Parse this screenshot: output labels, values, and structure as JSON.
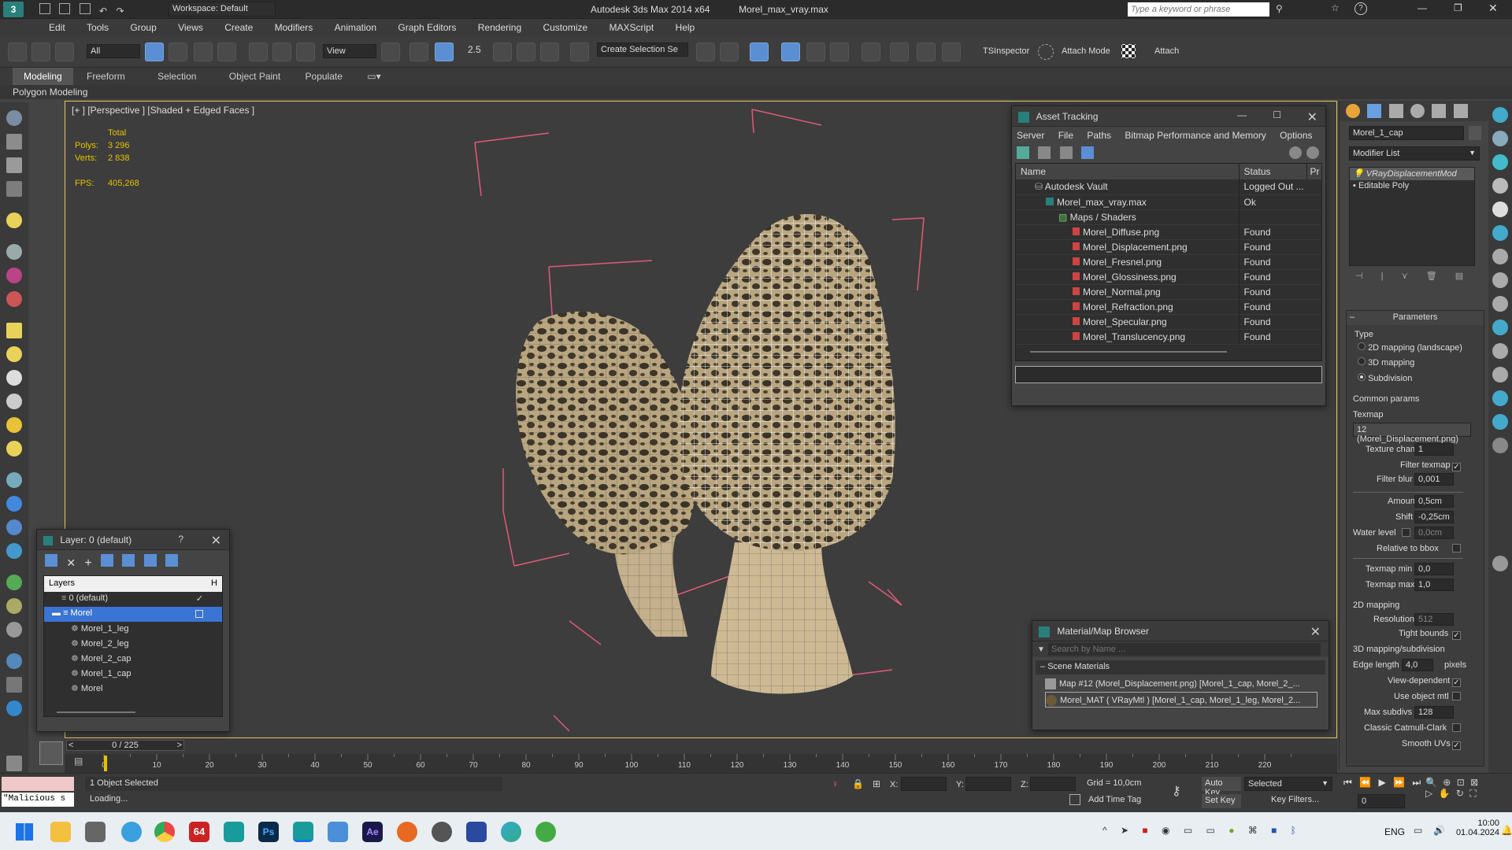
{
  "titlebar": {
    "workspace": "Workspace: Default",
    "app_title": "Autodesk 3ds Max 2014 x64",
    "file_title": "Morel_max_vray.max",
    "search_placeholder": "Type a keyword or phrase"
  },
  "menu": [
    "Edit",
    "Tools",
    "Group",
    "Views",
    "Create",
    "Modifiers",
    "Animation",
    "Graph Editors",
    "Rendering",
    "Customize",
    "MAXScript",
    "Help"
  ],
  "toolbar": {
    "selection_filter": "All",
    "view_dropdown": "View",
    "snap_value": "2.5",
    "create_selection": "Create Selection Se",
    "tsinspector": "TSInspector",
    "attach_mode": "Attach Mode",
    "attach": "Attach"
  },
  "ribbon": {
    "tabs": [
      "Modeling",
      "Freeform",
      "Selection",
      "Object Paint",
      "Populate"
    ],
    "sub_label": "Polygon Modeling"
  },
  "viewport": {
    "label": "[+ ] [Perspective ] [Shaded + Edged Faces ]",
    "stats": {
      "total_label": "Total",
      "polys_label": "Polys:",
      "polys_value": "3 296",
      "verts_label": "Verts:",
      "verts_value": "2 838",
      "fps_label": "FPS:",
      "fps_value": "405,268"
    }
  },
  "asset_tracking": {
    "title": "Asset Tracking",
    "menu": [
      "Server",
      "File",
      "Paths",
      "Bitmap Performance and Memory",
      "Options"
    ],
    "columns": [
      "Name",
      "Status",
      "Pr"
    ],
    "rows": [
      {
        "name": "Autodesk Vault",
        "status": "Logged Out ..."
      },
      {
        "name": "Morel_max_vray.max",
        "status": "Ok"
      },
      {
        "name": "Maps / Shaders",
        "status": ""
      },
      {
        "name": "Morel_Diffuse.png",
        "status": "Found"
      },
      {
        "name": "Morel_Displacement.png",
        "status": "Found"
      },
      {
        "name": "Morel_Fresnel.png",
        "status": "Found"
      },
      {
        "name": "Morel_Glossiness.png",
        "status": "Found"
      },
      {
        "name": "Morel_Normal.png",
        "status": "Found"
      },
      {
        "name": "Morel_Refraction.png",
        "status": "Found"
      },
      {
        "name": "Morel_Specular.png",
        "status": "Found"
      },
      {
        "name": "Morel_Translucency.png",
        "status": "Found"
      }
    ]
  },
  "layer_window": {
    "title": "Layer: 0 (default)",
    "help": "?",
    "header": "Layers",
    "header_h": "H",
    "items": [
      {
        "name": "0 (default)"
      },
      {
        "name": "Morel"
      },
      {
        "name": "Morel_1_leg"
      },
      {
        "name": "Morel_2_leg"
      },
      {
        "name": "Morel_2_cap"
      },
      {
        "name": "Morel_1_cap"
      },
      {
        "name": "Morel"
      }
    ]
  },
  "material_browser": {
    "title": "Material/Map Browser",
    "search_placeholder": "Search by Name ...",
    "section": "Scene Materials",
    "items": [
      "Map #12 (Morel_Displacement.png) [Morel_1_cap, Morel_2_...",
      "Morel_MAT ( VRayMtl ) [Morel_1_cap, Morel_1_leg, Morel_2..."
    ]
  },
  "command_panel": {
    "object_name": "Morel_1_cap",
    "modifier_list": "Modifier List",
    "stack": [
      "VRayDisplacementMod",
      "Editable Poly"
    ],
    "parameters_title": "Parameters",
    "type_label": "Type",
    "type_options": [
      "2D mapping (landscape)",
      "3D mapping",
      "Subdivision"
    ],
    "common_params": "Common params",
    "texmap_label": "Texmap",
    "texmap_value": "12 (Morel_Displacement.png)",
    "texture_chan_label": "Texture chan",
    "texture_chan_value": "1",
    "filter_texmap_label": "Filter texmap",
    "filter_blur_label": "Filter blur",
    "filter_blur_value": "0,001",
    "amount_label": "Amount",
    "amount_value": "0,5cm",
    "shift_label": "Shift",
    "shift_value": "-0,25cm",
    "water_level_label": "Water level",
    "water_level_value": "0,0cm",
    "relative_bbox_label": "Relative to bbox",
    "texmap_min_label": "Texmap min",
    "texmap_min_value": "0,0",
    "texmap_max_label": "Texmap max",
    "texmap_max_value": "1,0",
    "mapping2d_label": "2D mapping",
    "resolution_label": "Resolution",
    "resolution_value": "512",
    "tight_bounds_label": "Tight bounds",
    "mapping3d_label": "3D mapping/subdivision",
    "edge_length_label": "Edge length",
    "edge_length_value": "4,0",
    "pixels_label": "pixels",
    "view_dependent_label": "View-dependent",
    "use_object_mtl_label": "Use object mtl",
    "max_subdivs_label": "Max subdivs",
    "max_subdivs_value": "128",
    "catmull_label": "Classic Catmull-Clark",
    "smooth_uvs_label": "Smooth UVs"
  },
  "timeline": {
    "frame_counter": "0 / 225",
    "ticks": [
      "0",
      "10",
      "20",
      "30",
      "40",
      "50",
      "60",
      "70",
      "80",
      "90",
      "100",
      "110",
      "120",
      "130",
      "140",
      "150",
      "160",
      "170",
      "180",
      "190",
      "200",
      "210",
      "220"
    ]
  },
  "status": {
    "maxscript_listener": "\"Malicious s",
    "selection_info": "1 Object Selected",
    "loading": "Loading...",
    "x_label": "X:",
    "y_label": "Y:",
    "z_label": "Z:",
    "grid": "Grid = 10,0cm",
    "auto_key": "Auto Key",
    "selected_dropdown": "Selected",
    "set_key": "Set Key",
    "key_filters": "Key Filters...",
    "add_time_tag": "Add Time Tag",
    "frame_value": "0"
  },
  "taskbar": {
    "lang": "ENG",
    "time": "10:00",
    "date": "01.04.2024",
    "badge_64": "64",
    "app_ps": "Ps",
    "app_ae": "Ae"
  },
  "colors": {
    "accent_blue": "#3a6fc4",
    "bbox_red": "#e05a78",
    "stat_yellow": "#e6c200"
  }
}
